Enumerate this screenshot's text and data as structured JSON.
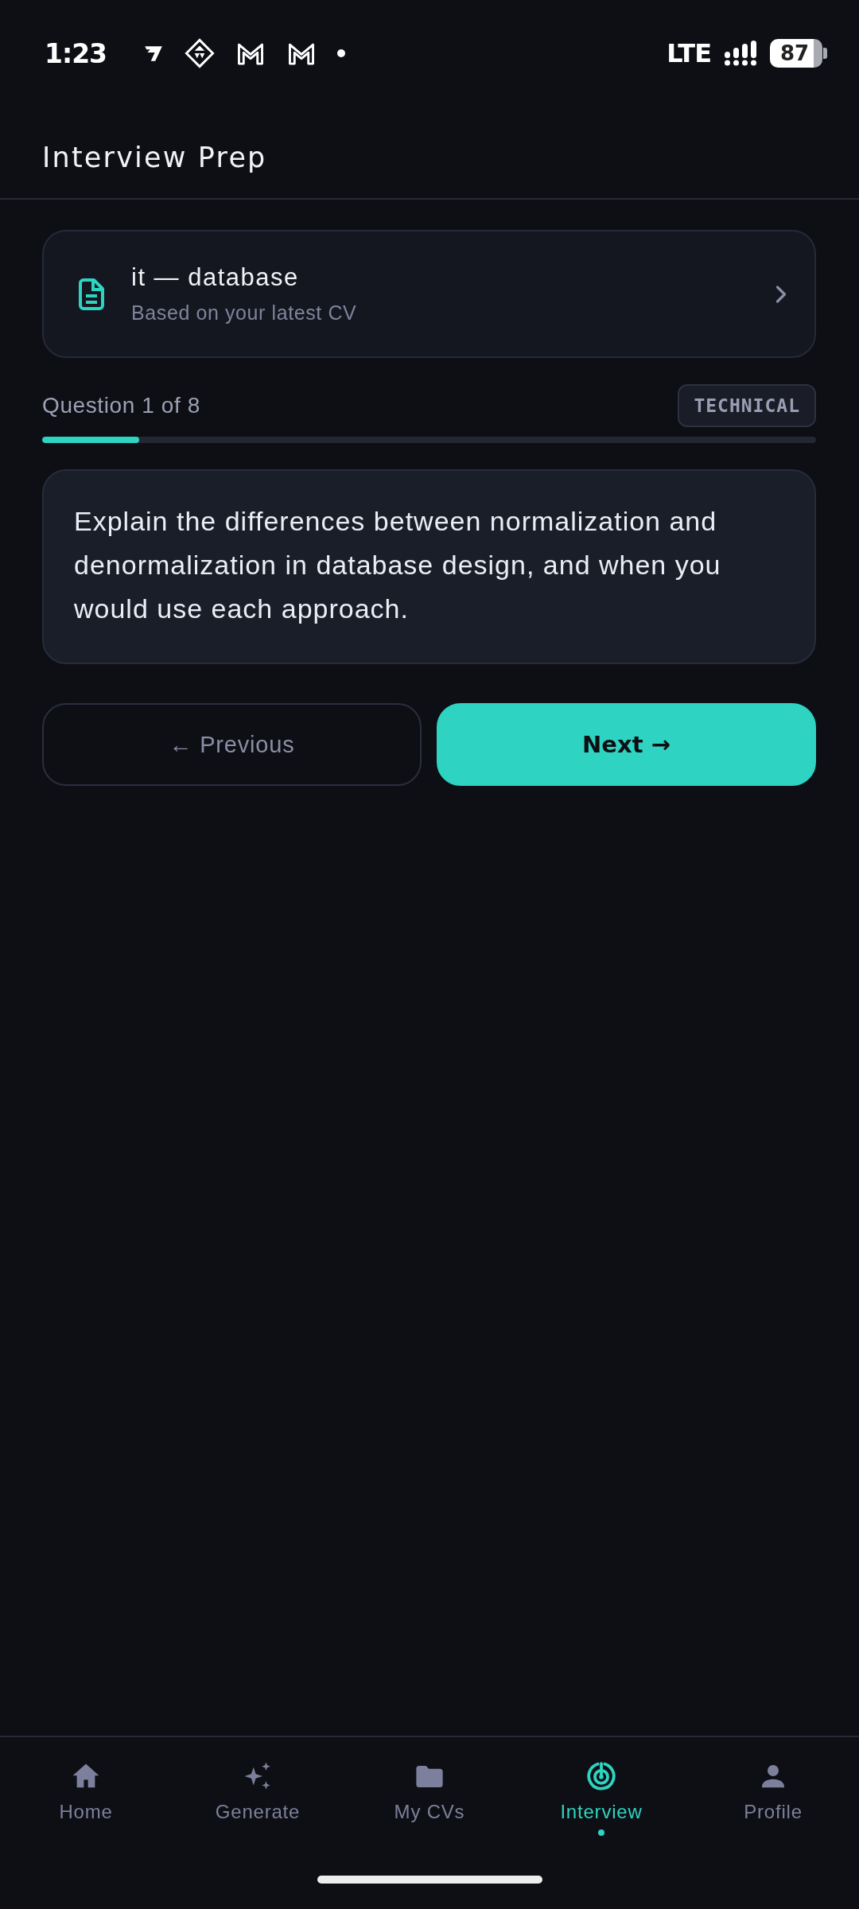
{
  "status_bar": {
    "time": "1:23",
    "network": "LTE",
    "battery": "87"
  },
  "header": {
    "title": "Interview Prep"
  },
  "cv_card": {
    "title": "it — database",
    "subtitle": "Based on your latest CV"
  },
  "progress": {
    "label": "Question 1 of 8",
    "category": "TECHNICAL",
    "level": 0.125
  },
  "question": {
    "text": "Explain the differences between normalization and denormalization in database design, and when you would use each approach."
  },
  "buttons": [
    {
      "kind": "previous",
      "label": "← Previous"
    },
    {
      "kind": "next",
      "label": "Next →"
    }
  ],
  "bottom_nav": [
    {
      "kind": "home",
      "label": "Home",
      "selected": false
    },
    {
      "kind": "generate",
      "label": "Generate",
      "selected": false
    },
    {
      "kind": "cvs",
      "label": "My CVs",
      "selected": false
    },
    {
      "kind": "interview",
      "label": "Interview",
      "selected": true
    },
    {
      "kind": "profile",
      "label": "Profile",
      "selected": false
    }
  ]
}
